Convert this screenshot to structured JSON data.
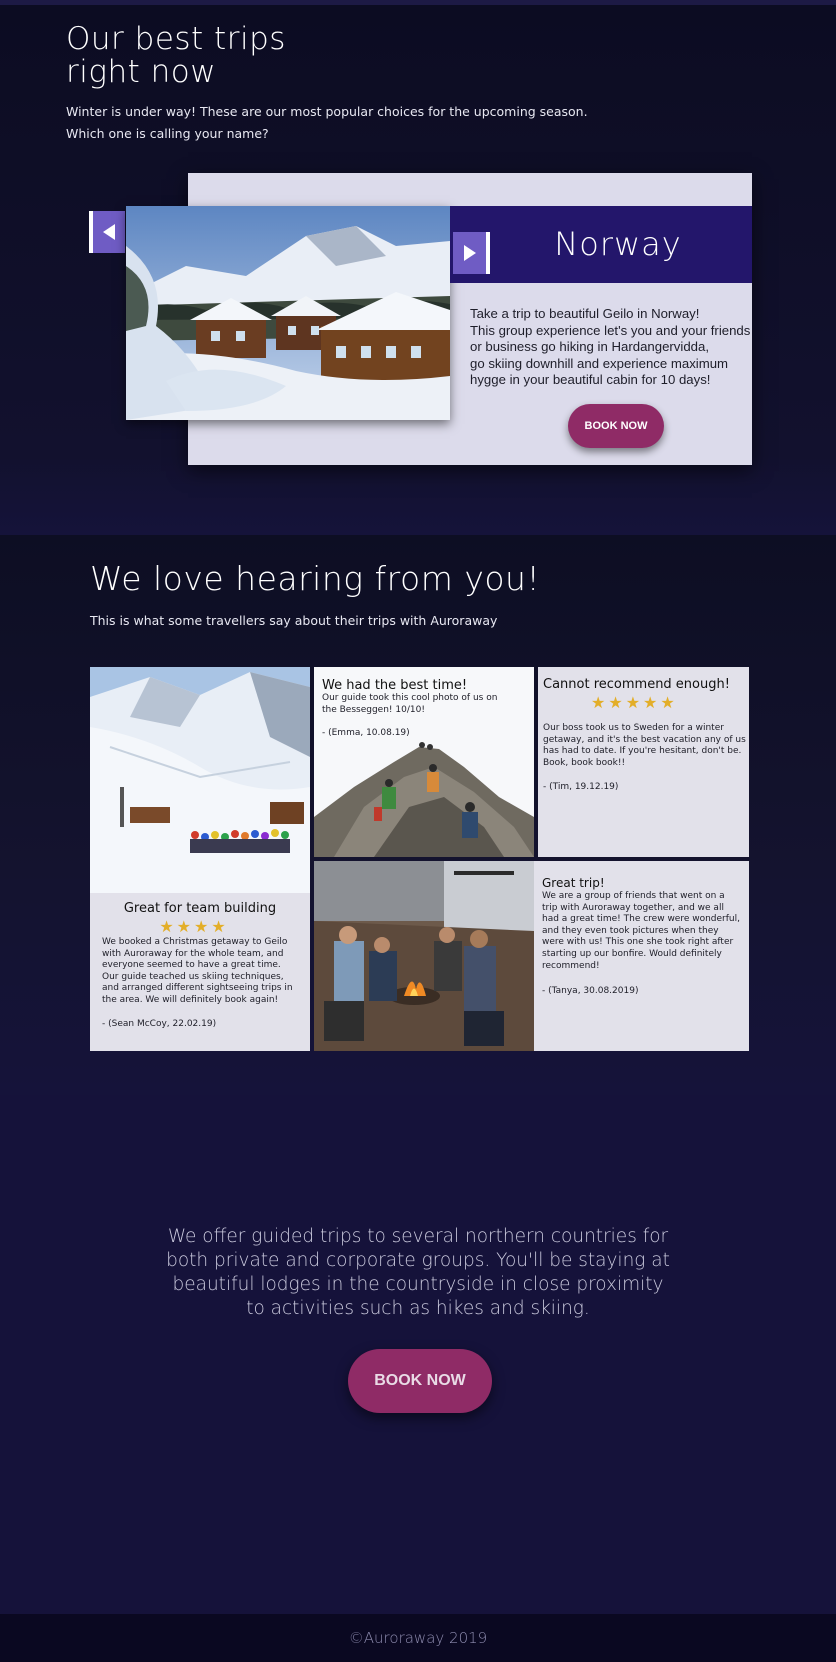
{
  "hero": {
    "title_line1": "Our best trips",
    "title_line2": "right now",
    "lead_line1": "Winter is under way! These are our most popular choices for the upcoming season.",
    "lead_line2": "Which one is calling your name?"
  },
  "featured_trip": {
    "title": "Norway",
    "description_lines": [
      "Take a trip to beautiful Geilo in Norway!",
      "This group experience let's you and your friends",
      "or business go hiking in Hardangervidda,",
      "go skiing downhill and experience maximum",
      "hygge in your beautiful cabin for 10 days!"
    ],
    "book_label": "BOOK NOW"
  },
  "testimonials": {
    "title": "We love hearing from you!",
    "subtitle": "This is what some travellers say about their trips with Auroraway",
    "reviews": [
      {
        "title": "Great for team building",
        "stars": "★★★★",
        "rating": 4,
        "text_lines": [
          "We booked a Christmas getaway to Geilo",
          "with Auroraway for the whole team, and",
          "everyone seemed to have a great time.",
          "Our guide teached us skiing techniques,",
          "and arranged different sightseeing trips in",
          "the area.  We will definitely book again!"
        ],
        "author": "- (Sean McCoy, 22.02.19)"
      },
      {
        "title": "We had the best time!",
        "text_lines": [
          "Our guide took this cool photo of us on",
          "the Besseggen! 10/10!"
        ],
        "author": "- (Emma, 10.08.19)"
      },
      {
        "title": "Cannot recommend enough!",
        "stars": "★★★★★",
        "rating": 5,
        "text_lines": [
          "Our boss took us to Sweden for a winter",
          "getaway, and it's the best vacation any of us",
          "has had to date. If you're hesitant, don't be.",
          "Book, book book!!"
        ],
        "author": "- (Tim, 19.12.19)"
      },
      {
        "title": "Great trip!",
        "text_lines": [
          "We are a group of friends that went on a",
          "trip with Auroraway together, and we all",
          "had a great time! The crew were wonderful,",
          "and they even took pictures when they",
          "were with us! This one she took right after",
          "starting up our bonfire. Would definitely",
          "recommend!"
        ],
        "author": "- (Tanya, 30.08.2019)"
      }
    ]
  },
  "offer": {
    "lines": [
      "We offer guided trips to several northern countries for",
      "both private and corporate groups. You'll be staying at",
      "beautiful lodges in the countryside in close proximity",
      "to activities such as hikes and skiing."
    ],
    "book_label": "BOOK NOW"
  },
  "footer": {
    "copyright": "©Auroraway 2019"
  },
  "colors": {
    "accent": "#8f2b66",
    "header_band": "#23166b",
    "arrow": "#6f5cc4",
    "star": "#e3ae29",
    "card_bg": "#dcdbeb"
  },
  "icons": [
    "arrow-left-icon",
    "arrow-right-icon",
    "star-icon"
  ]
}
